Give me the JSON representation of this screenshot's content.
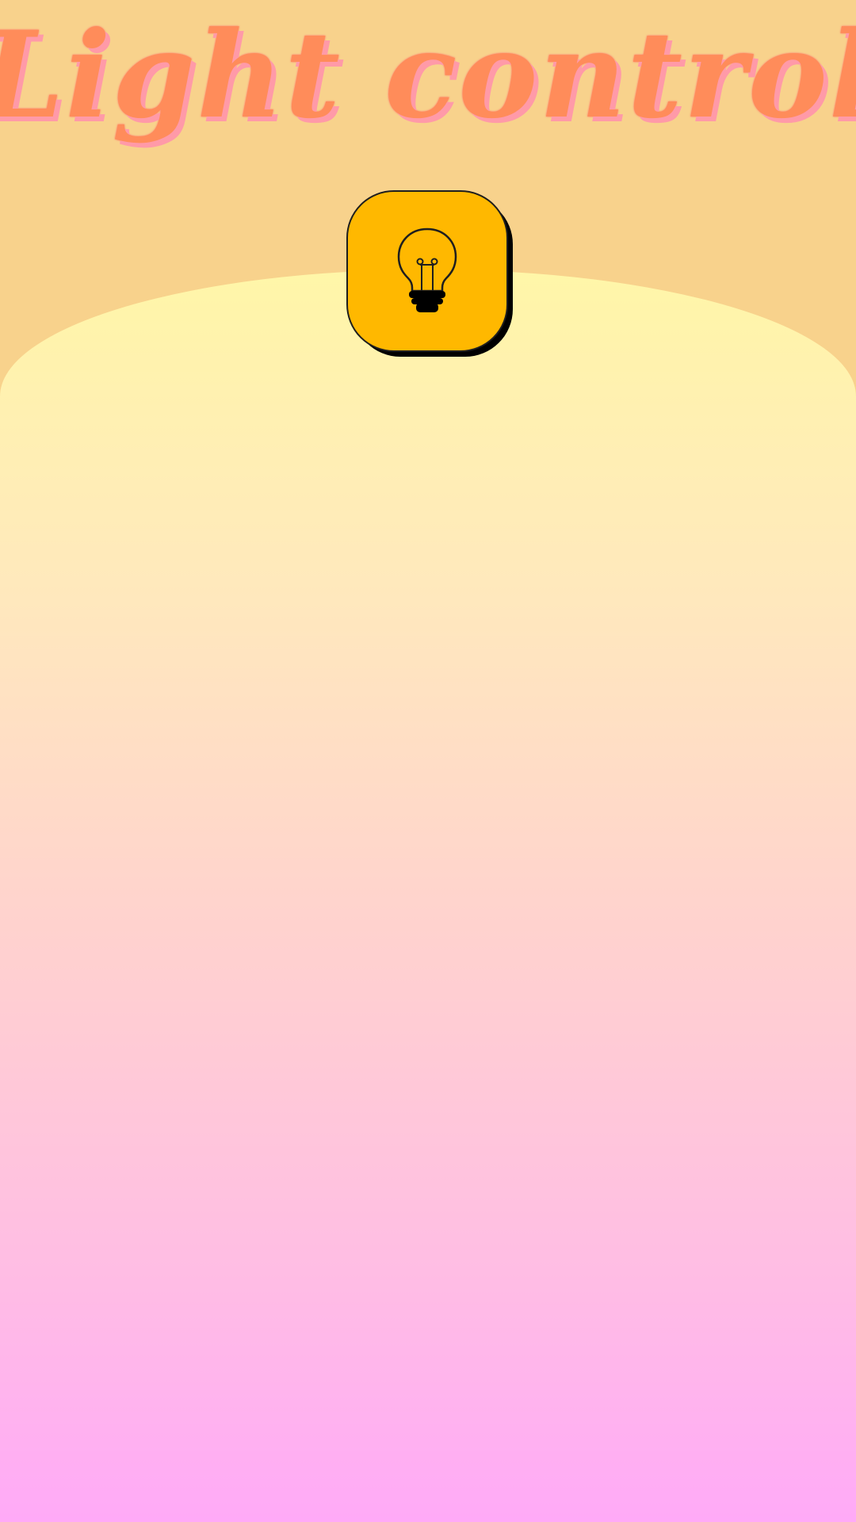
{
  "header": {
    "title": "Light control"
  },
  "light_switch": {
    "icon": "lightbulb-icon",
    "state_color": "#ffb800"
  },
  "colors": {
    "background_top": "#f8d28c",
    "title": "#ff8c5a",
    "title_shadow": "#ff9aa8",
    "gradient_top": "#fff6a8",
    "gradient_bottom": "#ffaaf7"
  }
}
